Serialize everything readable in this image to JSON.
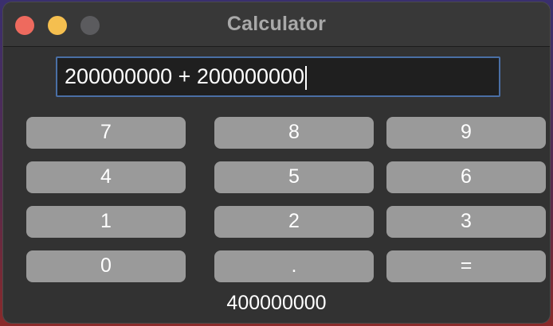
{
  "window": {
    "title": "Calculator"
  },
  "display": {
    "expression": "200000000 + 200000000"
  },
  "keypad": {
    "k7": "7",
    "k8": "8",
    "k9": "9",
    "k4": "4",
    "k5": "5",
    "k6": "6",
    "k1": "1",
    "k2": "2",
    "k3": "3",
    "k0": "0",
    "dot": ".",
    "equals": "="
  },
  "result": "400000000",
  "colors": {
    "close": "#ee6a5e",
    "minimize": "#f5bf4f",
    "zoom_disabled": "#5b5b5e",
    "button": "#9a9a9a",
    "focus_ring": "#4a6fa5"
  }
}
